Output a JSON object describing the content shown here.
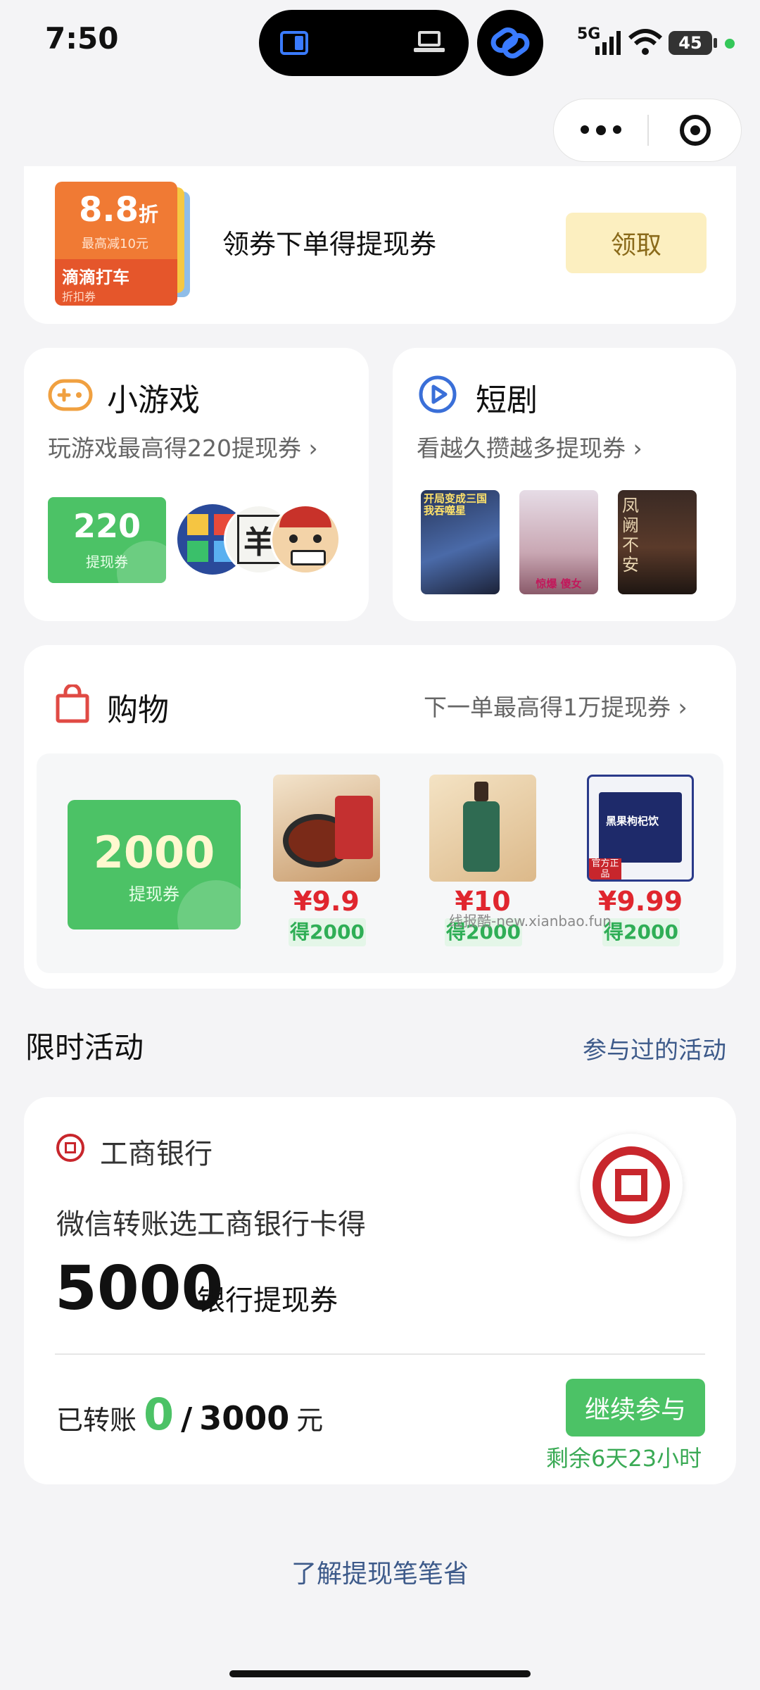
{
  "status_bar": {
    "time": "7:50",
    "network": "5G",
    "battery": "45"
  },
  "capsule": {
    "more_label": "•••"
  },
  "coupon_banner": {
    "discount_value": "8.8",
    "discount_unit": "折",
    "discount_note": "最高减10元",
    "brand": "滴滴打车",
    "brand_sub": "折扣券",
    "text": "领券下单得提现券",
    "button": "领取"
  },
  "games": {
    "title": "小游戏",
    "subtitle": "玩游戏最高得220提现券",
    "voucher_value": "220",
    "voucher_label": "提现券",
    "sheep_char": "羊"
  },
  "dramas": {
    "title": "短剧",
    "subtitle": "看越久攒越多提现券",
    "posters": [
      "开局变成三国 我吞噬星",
      "惊爆 傻女",
      "凤阙不安"
    ]
  },
  "shopping": {
    "title": "购物",
    "subtitle": "下一单最高得1万提现券",
    "voucher_value": "2000",
    "voucher_label": "提现券",
    "products": [
      {
        "price": "¥9.9",
        "gain": "得2000"
      },
      {
        "price": "¥10",
        "gain": "得2000"
      },
      {
        "price": "¥9.99",
        "gain": "得2000",
        "tag": "官方正品",
        "box_title": "黑果枸杞饮"
      }
    ],
    "watermark": "线报酷-new.xianbao.fun"
  },
  "limited": {
    "title": "限时活动",
    "history_link": "参与过的活动"
  },
  "bank_card": {
    "bank_name": "工商银行",
    "desc": "微信转账选工商银行卡得",
    "amount": "5000",
    "amount_unit": "银行提现券",
    "progress_label": "已转账",
    "progress_current": "0",
    "progress_sep": "/",
    "progress_target": "3000",
    "progress_unit": "元",
    "button": "继续参与",
    "remaining": "剩余6天23小时"
  },
  "footer_link": "了解提现笔笔省",
  "colors": {
    "green": "#4cc266",
    "orange": "#f06a2b",
    "red": "#c8262c",
    "link": "#3d5a8a"
  }
}
